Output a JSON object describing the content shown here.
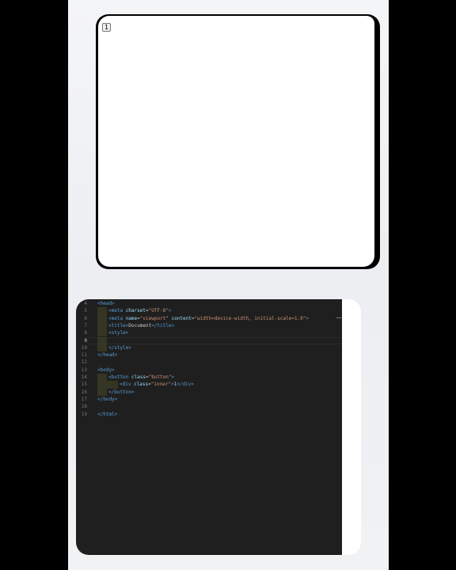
{
  "preview": {
    "button_label": "1"
  },
  "editor": {
    "lines": [
      {
        "num": "4",
        "html": "<span class=\"tag\">&lt;head&gt;</span>"
      },
      {
        "num": "5",
        "html": "<span class=\"tag\">&lt;meta</span> <span class=\"attr\">charset</span>=<span class=\"str\">\"UTF-8\"</span><span class=\"tag\">&gt;</span>",
        "indent": 1
      },
      {
        "num": "6",
        "html": "<span class=\"tag\">&lt;meta</span> <span class=\"attr\">name</span>=<span class=\"str\">\"viewport\"</span> <span class=\"attr\">content</span>=<span class=\"str\">\"width=device-width, initial-scale=1.0\"</span><span class=\"tag\">&gt;</span>",
        "indent": 1
      },
      {
        "num": "7",
        "html": "<span class=\"tag\">&lt;title&gt;</span><span class=\"txt\">Document</span><span class=\"tag\">&lt;/title&gt;</span>",
        "indent": 1
      },
      {
        "num": "8",
        "html": "<span class=\"tag\">&lt;style&gt;</span>",
        "indent": 1
      },
      {
        "num": "9",
        "html": "",
        "indent": 1,
        "active": true
      },
      {
        "num": "10",
        "html": "<span class=\"tag\">&lt;/style&gt;</span>",
        "indent": 1
      },
      {
        "num": "11",
        "html": "<span class=\"tag\">&lt;/head&gt;</span>"
      },
      {
        "num": "12",
        "html": ""
      },
      {
        "num": "13",
        "html": "<span class=\"tag\">&lt;body&gt;</span>"
      },
      {
        "num": "14",
        "html": "<span class=\"tag\">&lt;button</span> <span class=\"attr\">class</span>=<span class=\"str\">\"button\"</span><span class=\"tag\">&gt;</span>",
        "indent": 1
      },
      {
        "num": "15",
        "html": "<span class=\"tag\">&lt;div</span> <span class=\"attr\">class</span>=<span class=\"str\">\"inner\"</span><span class=\"tag\">&gt;</span><span class=\"txt\">1</span><span class=\"tag\">&lt;/div&gt;</span>",
        "indent": 2
      },
      {
        "num": "16",
        "html": "<span class=\"tag\">&lt;/button&gt;</span>",
        "indent": 1
      },
      {
        "num": "17",
        "html": "<span class=\"tag\">&lt;/body&gt;</span>"
      },
      {
        "num": "18",
        "html": ""
      },
      {
        "num": "19",
        "html": "<span class=\"tag\">&lt;/html&gt;</span>"
      }
    ]
  }
}
